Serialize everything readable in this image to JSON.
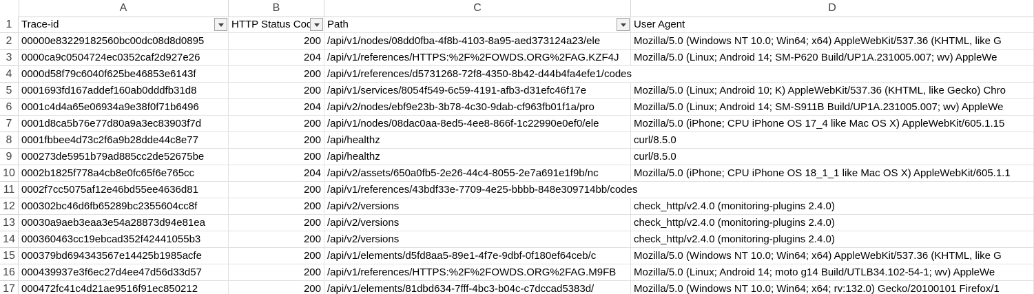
{
  "columns": [
    "A",
    "B",
    "C",
    "D"
  ],
  "header": {
    "trace_id": "Trace-id",
    "http_status": "HTTP Status Code",
    "path": "Path",
    "user_agent": "User Agent"
  },
  "rows": [
    {
      "num": "2",
      "trace_id": "00000e83229182560bc00dc08d8d0895",
      "status": "200",
      "path": "/api/v1/nodes/08dd0fba-4f8b-4103-8a95-aed373124a23/ele",
      "ua": "Mozilla/5.0 (Windows NT 10.0; Win64; x64) AppleWebKit/537.36 (KHTML, like G"
    },
    {
      "num": "3",
      "trace_id": "0000ca9c0504724ec0352caf2d927e26",
      "status": "204",
      "path": "/api/v1/references/HTTPS:%2F%2FOWDS.ORG%2FAG.KZF4J",
      "ua": "Mozilla/5.0 (Linux; Android 14; SM-P620 Build/UP1A.231005.007; wv) AppleWe"
    },
    {
      "num": "4",
      "trace_id": "0000d58f79c6040f625be46853e6143f",
      "status": "200",
      "path": "/api/v1/references/d5731268-72f8-4350-8b42-d44b4fa4efe1/codes",
      "ua": ""
    },
    {
      "num": "5",
      "trace_id": "0001693fd167addef160ab0dddfb31d8",
      "status": "200",
      "path": "/api/v1/services/8054f549-6c59-4191-afb3-d31efc46f17e",
      "ua": "Mozilla/5.0 (Linux; Android 10; K) AppleWebKit/537.36 (KHTML, like Gecko) Chro"
    },
    {
      "num": "6",
      "trace_id": "0001c4d4a65e06934a9e38f0f71b6496",
      "status": "204",
      "path": "/api/v2/nodes/ebf9e23b-3b78-4c30-9dab-cf963fb01f1a/pro",
      "ua": "Mozilla/5.0 (Linux; Android 14; SM-S911B Build/UP1A.231005.007; wv) AppleWe"
    },
    {
      "num": "7",
      "trace_id": "0001d8ca5b76e77d80a9a3ec83903f7d",
      "status": "200",
      "path": "/api/v1/nodes/08dac0aa-8ed5-4ee8-866f-1c22990e0ef0/ele",
      "ua": "Mozilla/5.0 (iPhone; CPU iPhone OS 17_4 like Mac OS X) AppleWebKit/605.1.15"
    },
    {
      "num": "8",
      "trace_id": "0001fbbee4d73c2f6a9b28dde44c8e77",
      "status": "200",
      "path": "/api/healthz",
      "ua": "curl/8.5.0"
    },
    {
      "num": "9",
      "trace_id": "000273de5951b79ad885cc2de52675be",
      "status": "200",
      "path": "/api/healthz",
      "ua": "curl/8.5.0"
    },
    {
      "num": "10",
      "trace_id": "0002b1825f778a4cb8e0fc65f6e765cc",
      "status": "204",
      "path": "/api/v2/assets/650a0fb5-2e26-44c4-8055-2e7a691e1f9b/nc",
      "ua": "Mozilla/5.0 (iPhone; CPU iPhone OS 18_1_1 like Mac OS X) AppleWebKit/605.1.1"
    },
    {
      "num": "11",
      "trace_id": "0002f7cc5075af12e46bd55ee4636d81",
      "status": "200",
      "path": "/api/v1/references/43bdf33e-7709-4e25-bbbb-848e309714bb/codes",
      "ua": ""
    },
    {
      "num": "12",
      "trace_id": "000302bc46d6fb65289bc2355604cc8f",
      "status": "200",
      "path": "/api/v2/versions",
      "ua": "check_http/v2.4.0 (monitoring-plugins 2.4.0)"
    },
    {
      "num": "13",
      "trace_id": "00030a9aeb3eaa3e54a28873d94e81ea",
      "status": "200",
      "path": "/api/v2/versions",
      "ua": "check_http/v2.4.0 (monitoring-plugins 2.4.0)"
    },
    {
      "num": "14",
      "trace_id": "000360463cc19ebcad352f42441055b3",
      "status": "200",
      "path": "/api/v2/versions",
      "ua": "check_http/v2.4.0 (monitoring-plugins 2.4.0)"
    },
    {
      "num": "15",
      "trace_id": "000379bd694343567e14425b1985acfe",
      "status": "200",
      "path": "/api/v1/elements/d5fd8aa5-89e1-4f7e-9dbf-0f180ef64ceb/c",
      "ua": "Mozilla/5.0 (Windows NT 10.0; Win64; x64) AppleWebKit/537.36 (KHTML, like G"
    },
    {
      "num": "16",
      "trace_id": "000439937e3f6ec27d4ee47d56d33d57",
      "status": "200",
      "path": "/api/v1/references/HTTPS:%2F%2FOWDS.ORG%2FAG.M9FB",
      "ua": "Mozilla/5.0 (Linux; Android 14; moto g14 Build/UTLB34.102-54-1; wv) AppleWe"
    },
    {
      "num": "17",
      "trace_id": "000472fc41c4d21ae9516f91ec850212",
      "status": "200",
      "path": "/api/v1/elements/81dbd634-7fff-4bc3-b04c-c7dccad5383d/",
      "ua": "Mozilla/5.0 (Windows NT 10.0; Win64; x64; rv:132.0) Gecko/20100101 Firefox/1"
    }
  ]
}
